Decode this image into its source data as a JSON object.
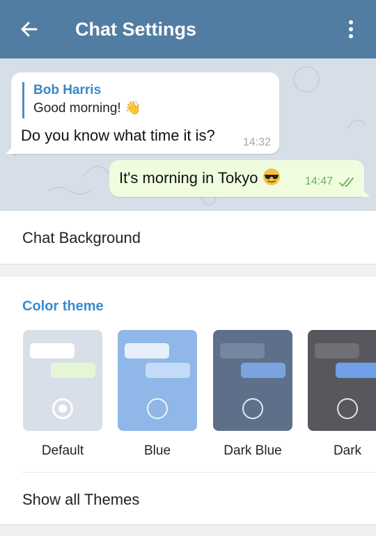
{
  "appbar": {
    "title": "Chat Settings",
    "back_icon": "arrow-left-icon",
    "menu_icon": "more-vertical-icon",
    "color": "#517da2"
  },
  "preview": {
    "incoming": {
      "reply_name": "Bob Harris",
      "reply_text": "Good morning!",
      "reply_emoji": "👋",
      "text": "Do you know what time it is?",
      "time": "14:32"
    },
    "outgoing": {
      "text": "It's morning in Tokyo",
      "emoji": "sunglasses-face",
      "time": "14:47",
      "status_icon": "double-check-icon"
    }
  },
  "chat_background": {
    "label": "Chat Background"
  },
  "color_theme": {
    "header": "Color theme",
    "accent": "#3a8bd0",
    "themes": [
      {
        "name": "Default",
        "bg": "#d8dfe8",
        "bubble_in": "#ffffff",
        "bubble_out": "#e5f6d7",
        "selected": true
      },
      {
        "name": "Blue",
        "bg": "#8fb7e8",
        "bubble_in": "#e6effb",
        "bubble_out": "#c4dbf7",
        "selected": false
      },
      {
        "name": "Dark Blue",
        "bg": "#5e7089",
        "bubble_in": "#7686a0",
        "bubble_out": "#7aa3e0",
        "selected": false
      },
      {
        "name": "Dark",
        "bg": "#56585d",
        "bubble_in": "#6e7075",
        "bubble_out": "#6f9fe6",
        "selected": false
      }
    ],
    "show_all": "Show all Themes"
  }
}
